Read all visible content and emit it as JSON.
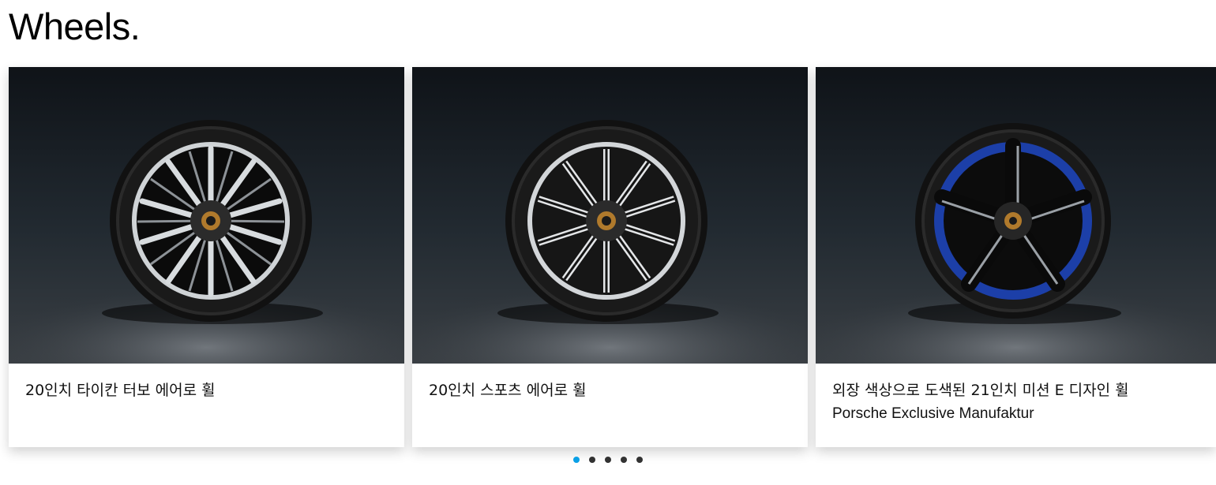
{
  "section": {
    "title": "Wheels."
  },
  "cards": [
    {
      "title": "20인치 타이칸 터보 에어로 휠",
      "subtitle": ""
    },
    {
      "title": "20인치 스포츠 에어로 휠",
      "subtitle": ""
    },
    {
      "title": "외장 색상으로 도색된 21인치 미션 E 디자인 휠",
      "subtitle": "Porsche Exclusive Manufaktur"
    }
  ],
  "pagination": {
    "count": 5,
    "active_index": 0,
    "active_color": "#0aa0e6",
    "inactive_color": "#323232"
  },
  "images": [
    {
      "icon": "wheel-turbo-aero-image"
    },
    {
      "icon": "wheel-sport-aero-image"
    },
    {
      "icon": "wheel-mission-e-design-image",
      "accent_color": "#1c3fa8"
    }
  ]
}
